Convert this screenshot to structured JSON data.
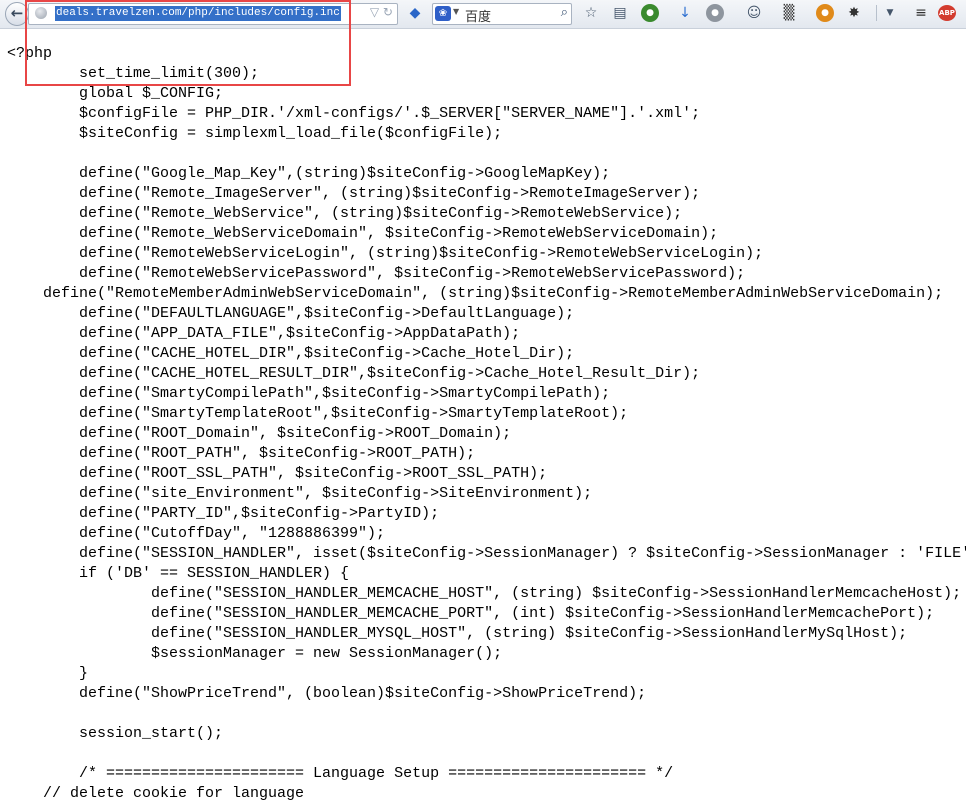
{
  "browser": {
    "url": "deals.travelzen.com/php/includes/config.inc",
    "search_placeholder": "百度"
  },
  "code_lines": [
    "<?php",
    "        set_time_limit(300);",
    "        global $_CONFIG;",
    "        $configFile = PHP_DIR.'/xml-configs/'.$_SERVER[\"SERVER_NAME\"].'.xml';",
    "        $siteConfig = simplexml_load_file($configFile);",
    "",
    "        define(\"Google_Map_Key\",(string)$siteConfig->GoogleMapKey);",
    "        define(\"Remote_ImageServer\", (string)$siteConfig->RemoteImageServer);",
    "        define(\"Remote_WebService\", (string)$siteConfig->RemoteWebService);",
    "        define(\"Remote_WebServiceDomain\", $siteConfig->RemoteWebServiceDomain);",
    "        define(\"RemoteWebServiceLogin\", (string)$siteConfig->RemoteWebServiceLogin);",
    "        define(\"RemoteWebServicePassword\", $siteConfig->RemoteWebServicePassword);",
    "    define(\"RemoteMemberAdminWebServiceDomain\", (string)$siteConfig->RemoteMemberAdminWebServiceDomain);",
    "        define(\"DEFAULTLANGUAGE\",$siteConfig->DefaultLanguage);",
    "        define(\"APP_DATA_FILE\",$siteConfig->AppDataPath);",
    "        define(\"CACHE_HOTEL_DIR\",$siteConfig->Cache_Hotel_Dir);",
    "        define(\"CACHE_HOTEL_RESULT_DIR\",$siteConfig->Cache_Hotel_Result_Dir);",
    "        define(\"SmartyCompilePath\",$siteConfig->SmartyCompilePath);",
    "        define(\"SmartyTemplateRoot\",$siteConfig->SmartyTemplateRoot);",
    "        define(\"ROOT_Domain\", $siteConfig->ROOT_Domain);",
    "        define(\"ROOT_PATH\", $siteConfig->ROOT_PATH);",
    "        define(\"ROOT_SSL_PATH\", $siteConfig->ROOT_SSL_PATH);",
    "        define(\"site_Environment\", $siteConfig->SiteEnvironment);",
    "        define(\"PARTY_ID\",$siteConfig->PartyID);",
    "        define(\"CutoffDay\", \"1288886399\");",
    "        define(\"SESSION_HANDLER\", isset($siteConfig->SessionManager) ? $siteConfig->SessionManager : 'FILE');",
    "        if ('DB' == SESSION_HANDLER) {",
    "                define(\"SESSION_HANDLER_MEMCACHE_HOST\", (string) $siteConfig->SessionHandlerMemcacheHost);",
    "                define(\"SESSION_HANDLER_MEMCACHE_PORT\", (int) $siteConfig->SessionHandlerMemcachePort);",
    "                define(\"SESSION_HANDLER_MYSQL_HOST\", (string) $siteConfig->SessionHandlerMySqlHost);",
    "                $sessionManager = new SessionManager();",
    "        }",
    "        define(\"ShowPriceTrend\", (boolean)$siteConfig->ShowPriceTrend);",
    "",
    "        session_start();",
    "",
    "        /* ====================== Language Setup ====================== */",
    "    // delete cookie for language"
  ],
  "toolbar_icons": [
    "back-arrow-icon",
    "globe-icon",
    "star-icon",
    "reader-icon",
    "green-ball-icon",
    "download-icon",
    "gray-ball-icon",
    "smiley-icon",
    "qr-icon",
    "firefox-icon",
    "bug-icon",
    "menu-icon",
    "abp-icon"
  ],
  "colors": {
    "highlight_box": "#e84646",
    "url_selection": "#3470c8"
  }
}
